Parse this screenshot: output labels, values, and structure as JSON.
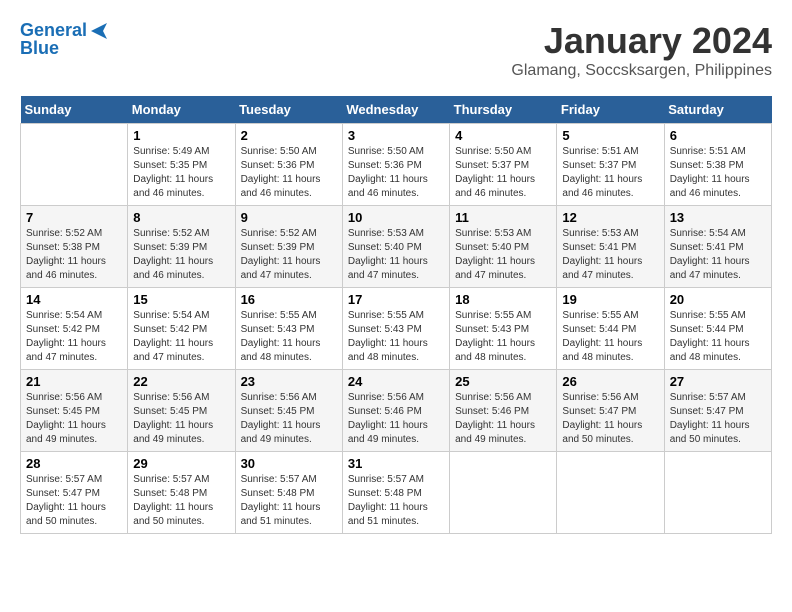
{
  "logo": {
    "line1": "General",
    "line2": "Blue"
  },
  "title": "January 2024",
  "subtitle": "Glamang, Soccsksargen, Philippines",
  "days_of_week": [
    "Sunday",
    "Monday",
    "Tuesday",
    "Wednesday",
    "Thursday",
    "Friday",
    "Saturday"
  ],
  "weeks": [
    [
      {
        "day": "",
        "info": ""
      },
      {
        "day": "1",
        "info": "Sunrise: 5:49 AM\nSunset: 5:35 PM\nDaylight: 11 hours\nand 46 minutes."
      },
      {
        "day": "2",
        "info": "Sunrise: 5:50 AM\nSunset: 5:36 PM\nDaylight: 11 hours\nand 46 minutes."
      },
      {
        "day": "3",
        "info": "Sunrise: 5:50 AM\nSunset: 5:36 PM\nDaylight: 11 hours\nand 46 minutes."
      },
      {
        "day": "4",
        "info": "Sunrise: 5:50 AM\nSunset: 5:37 PM\nDaylight: 11 hours\nand 46 minutes."
      },
      {
        "day": "5",
        "info": "Sunrise: 5:51 AM\nSunset: 5:37 PM\nDaylight: 11 hours\nand 46 minutes."
      },
      {
        "day": "6",
        "info": "Sunrise: 5:51 AM\nSunset: 5:38 PM\nDaylight: 11 hours\nand 46 minutes."
      }
    ],
    [
      {
        "day": "7",
        "info": "Sunrise: 5:52 AM\nSunset: 5:38 PM\nDaylight: 11 hours\nand 46 minutes."
      },
      {
        "day": "8",
        "info": "Sunrise: 5:52 AM\nSunset: 5:39 PM\nDaylight: 11 hours\nand 46 minutes."
      },
      {
        "day": "9",
        "info": "Sunrise: 5:52 AM\nSunset: 5:39 PM\nDaylight: 11 hours\nand 47 minutes."
      },
      {
        "day": "10",
        "info": "Sunrise: 5:53 AM\nSunset: 5:40 PM\nDaylight: 11 hours\nand 47 minutes."
      },
      {
        "day": "11",
        "info": "Sunrise: 5:53 AM\nSunset: 5:40 PM\nDaylight: 11 hours\nand 47 minutes."
      },
      {
        "day": "12",
        "info": "Sunrise: 5:53 AM\nSunset: 5:41 PM\nDaylight: 11 hours\nand 47 minutes."
      },
      {
        "day": "13",
        "info": "Sunrise: 5:54 AM\nSunset: 5:41 PM\nDaylight: 11 hours\nand 47 minutes."
      }
    ],
    [
      {
        "day": "14",
        "info": "Sunrise: 5:54 AM\nSunset: 5:42 PM\nDaylight: 11 hours\nand 47 minutes."
      },
      {
        "day": "15",
        "info": "Sunrise: 5:54 AM\nSunset: 5:42 PM\nDaylight: 11 hours\nand 47 minutes."
      },
      {
        "day": "16",
        "info": "Sunrise: 5:55 AM\nSunset: 5:43 PM\nDaylight: 11 hours\nand 48 minutes."
      },
      {
        "day": "17",
        "info": "Sunrise: 5:55 AM\nSunset: 5:43 PM\nDaylight: 11 hours\nand 48 minutes."
      },
      {
        "day": "18",
        "info": "Sunrise: 5:55 AM\nSunset: 5:43 PM\nDaylight: 11 hours\nand 48 minutes."
      },
      {
        "day": "19",
        "info": "Sunrise: 5:55 AM\nSunset: 5:44 PM\nDaylight: 11 hours\nand 48 minutes."
      },
      {
        "day": "20",
        "info": "Sunrise: 5:55 AM\nSunset: 5:44 PM\nDaylight: 11 hours\nand 48 minutes."
      }
    ],
    [
      {
        "day": "21",
        "info": "Sunrise: 5:56 AM\nSunset: 5:45 PM\nDaylight: 11 hours\nand 49 minutes."
      },
      {
        "day": "22",
        "info": "Sunrise: 5:56 AM\nSunset: 5:45 PM\nDaylight: 11 hours\nand 49 minutes."
      },
      {
        "day": "23",
        "info": "Sunrise: 5:56 AM\nSunset: 5:45 PM\nDaylight: 11 hours\nand 49 minutes."
      },
      {
        "day": "24",
        "info": "Sunrise: 5:56 AM\nSunset: 5:46 PM\nDaylight: 11 hours\nand 49 minutes."
      },
      {
        "day": "25",
        "info": "Sunrise: 5:56 AM\nSunset: 5:46 PM\nDaylight: 11 hours\nand 49 minutes."
      },
      {
        "day": "26",
        "info": "Sunrise: 5:56 AM\nSunset: 5:47 PM\nDaylight: 11 hours\nand 50 minutes."
      },
      {
        "day": "27",
        "info": "Sunrise: 5:57 AM\nSunset: 5:47 PM\nDaylight: 11 hours\nand 50 minutes."
      }
    ],
    [
      {
        "day": "28",
        "info": "Sunrise: 5:57 AM\nSunset: 5:47 PM\nDaylight: 11 hours\nand 50 minutes."
      },
      {
        "day": "29",
        "info": "Sunrise: 5:57 AM\nSunset: 5:48 PM\nDaylight: 11 hours\nand 50 minutes."
      },
      {
        "day": "30",
        "info": "Sunrise: 5:57 AM\nSunset: 5:48 PM\nDaylight: 11 hours\nand 51 minutes."
      },
      {
        "day": "31",
        "info": "Sunrise: 5:57 AM\nSunset: 5:48 PM\nDaylight: 11 hours\nand 51 minutes."
      },
      {
        "day": "",
        "info": ""
      },
      {
        "day": "",
        "info": ""
      },
      {
        "day": "",
        "info": ""
      }
    ]
  ]
}
